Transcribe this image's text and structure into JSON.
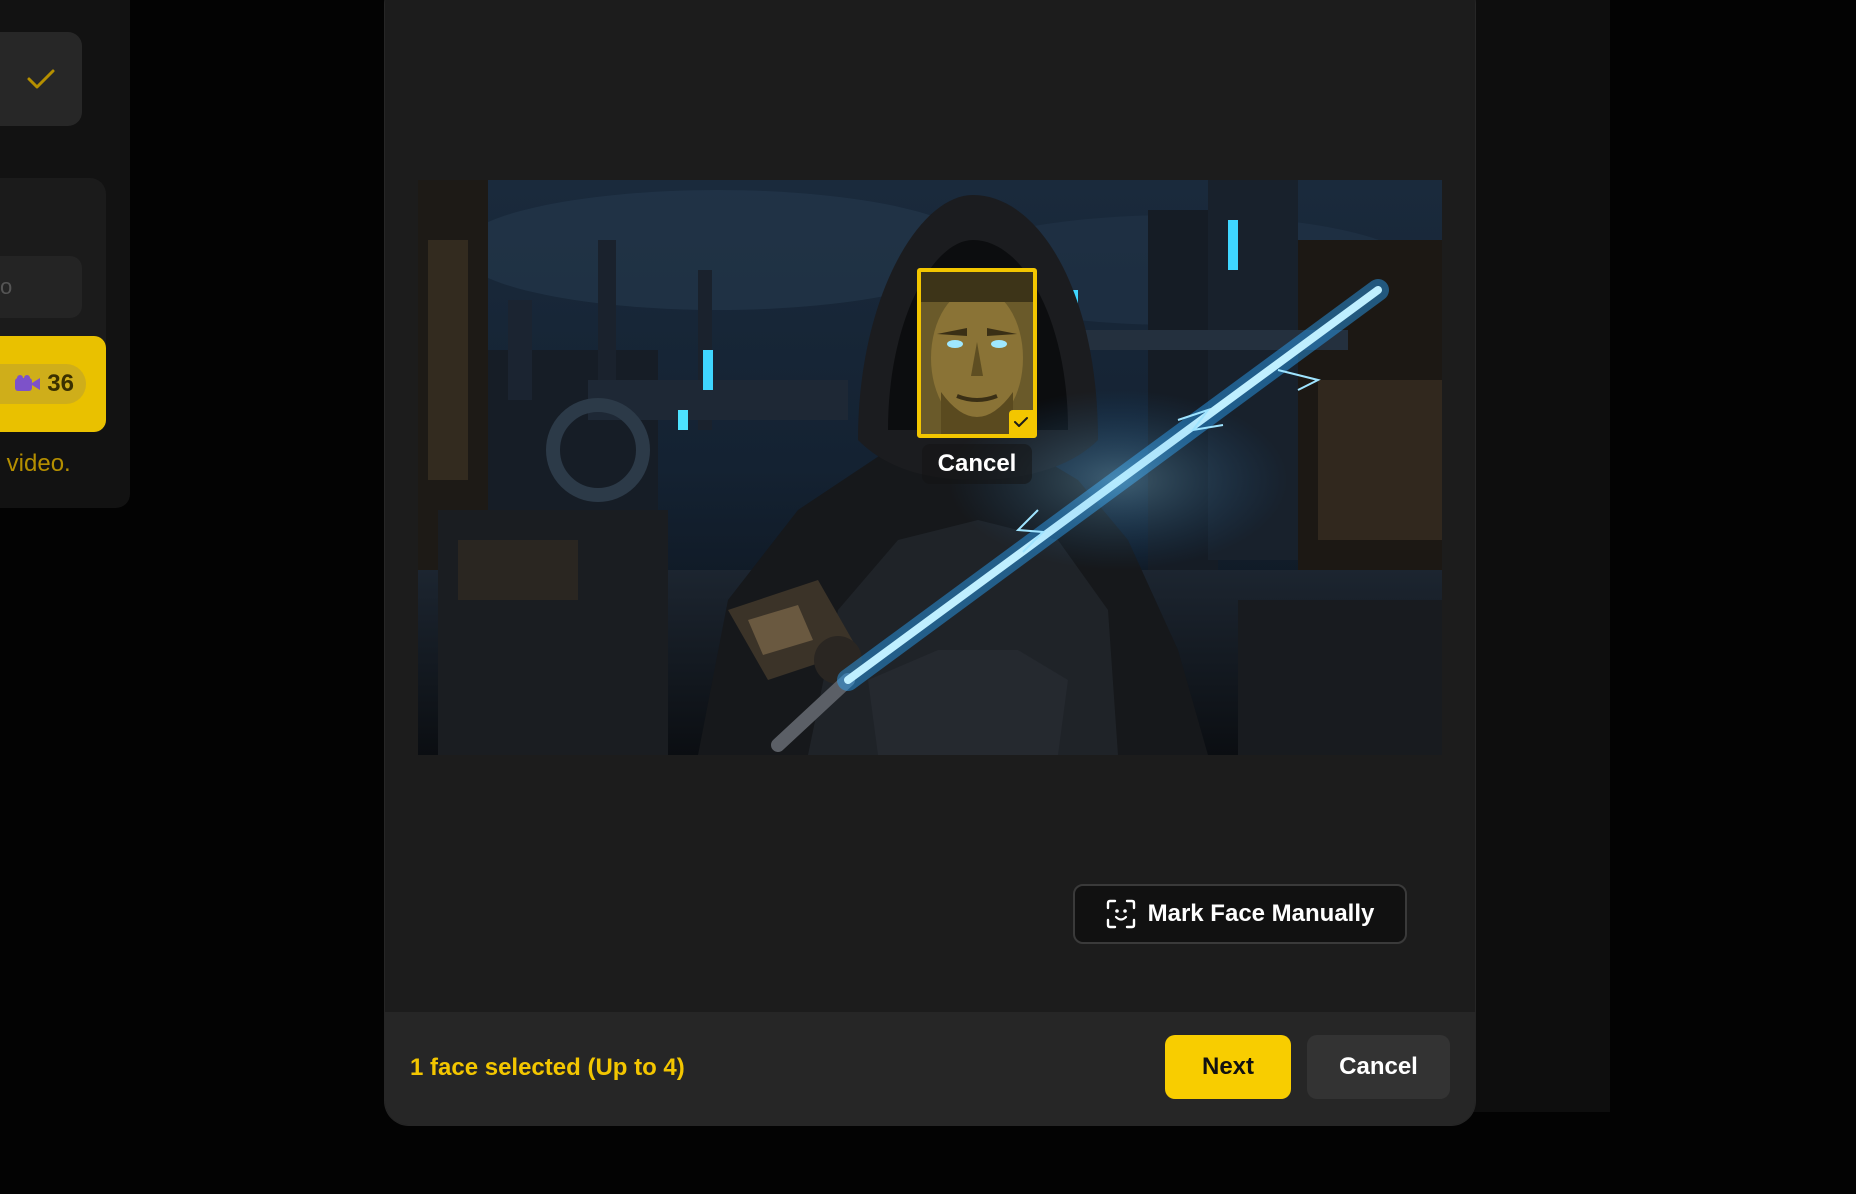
{
  "background": {
    "credit_count": "36",
    "hint_text": "r video.",
    "input_text": "o",
    "icons": {
      "check": "check-icon",
      "camera": "video-camera-icon"
    }
  },
  "modal": {
    "face": {
      "cancel_label": "Cancel",
      "selected": true
    },
    "mark_face_button": "Mark Face Manually",
    "footer": {
      "status": "1 face selected (Up to 4)",
      "next_label": "Next",
      "cancel_label": "Cancel"
    }
  },
  "colors": {
    "accent": "#f8cd00",
    "modal_bg": "#1c1c1c",
    "footer_bg": "#262626",
    "page_bg": "#030303"
  }
}
